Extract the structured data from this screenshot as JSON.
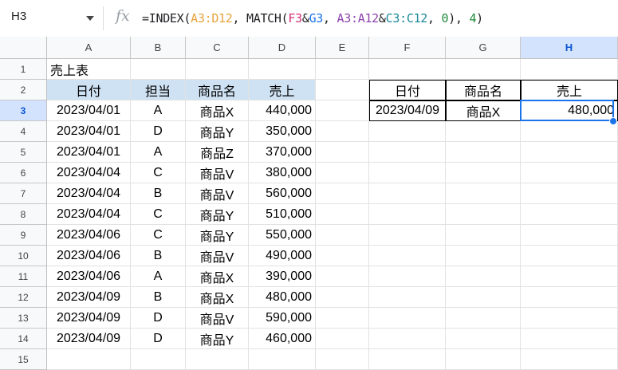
{
  "formula_bar": {
    "cell_ref": "H3",
    "fx_label": "fx",
    "formula_parts": [
      {
        "t": "=INDEX(",
        "c": "#202124"
      },
      {
        "t": "A3:D12",
        "c": "#e8a33c"
      },
      {
        "t": ", MATCH(",
        "c": "#202124"
      },
      {
        "t": "F3",
        "c": "#d5307a"
      },
      {
        "t": "&",
        "c": "#202124"
      },
      {
        "t": "G3",
        "c": "#1a73e8"
      },
      {
        "t": ", ",
        "c": "#202124"
      },
      {
        "t": "A3:A12",
        "c": "#8e44ad"
      },
      {
        "t": "&",
        "c": "#202124"
      },
      {
        "t": "C3:C12",
        "c": "#1a8a9a"
      },
      {
        "t": ", ",
        "c": "#202124"
      },
      {
        "t": "0",
        "c": "#1f8b3c"
      },
      {
        "t": "), ",
        "c": "#202124"
      },
      {
        "t": "4",
        "c": "#1f8b3c"
      },
      {
        "t": ")",
        "c": "#202124"
      }
    ]
  },
  "columns": [
    "A",
    "B",
    "C",
    "D",
    "E",
    "F",
    "G",
    "H"
  ],
  "rows": [
    "1",
    "2",
    "3",
    "4",
    "5",
    "6",
    "7",
    "8",
    "9",
    "10",
    "11",
    "12",
    "13",
    "14",
    "15"
  ],
  "selected": {
    "column": "H",
    "row": "3"
  },
  "table": {
    "title": "売上表",
    "headers": [
      "日付",
      "担当",
      "商品名",
      "売上"
    ],
    "rows": [
      [
        "2023/04/01",
        "A",
        "商品X",
        "440,000"
      ],
      [
        "2023/04/01",
        "D",
        "商品Y",
        "350,000"
      ],
      [
        "2023/04/01",
        "A",
        "商品Z",
        "370,000"
      ],
      [
        "2023/04/04",
        "C",
        "商品V",
        "380,000"
      ],
      [
        "2023/04/04",
        "B",
        "商品V",
        "560,000"
      ],
      [
        "2023/04/04",
        "C",
        "商品Y",
        "510,000"
      ],
      [
        "2023/04/06",
        "C",
        "商品Y",
        "550,000"
      ],
      [
        "2023/04/06",
        "B",
        "商品V",
        "490,000"
      ],
      [
        "2023/04/06",
        "A",
        "商品X",
        "390,000"
      ],
      [
        "2023/04/09",
        "B",
        "商品X",
        "480,000"
      ],
      [
        "2023/04/09",
        "D",
        "商品V",
        "590,000"
      ],
      [
        "2023/04/09",
        "D",
        "商品Y",
        "460,000"
      ]
    ]
  },
  "lookup": {
    "headers": [
      "日付",
      "商品名",
      "売上"
    ],
    "values": [
      "2023/04/09",
      "商品X",
      "480,000"
    ]
  },
  "colors": {
    "header_fill": "#cfe2f3",
    "selection": "#1a73e8"
  }
}
